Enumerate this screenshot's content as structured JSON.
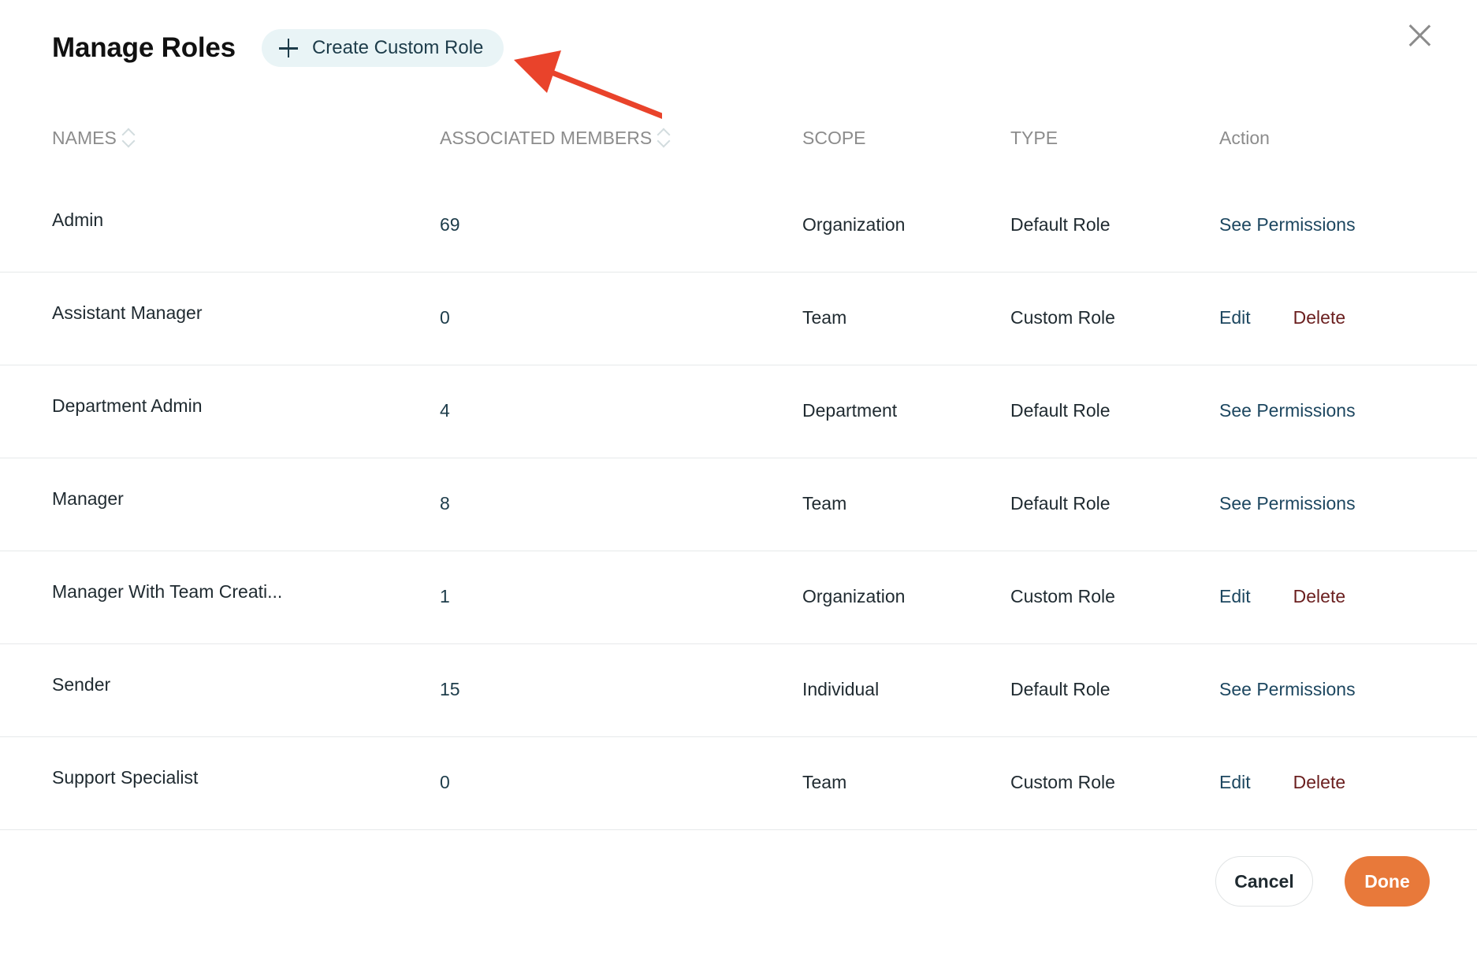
{
  "header": {
    "title": "Manage Roles",
    "create_button_label": "Create Custom Role",
    "create_icon": "plus-icon",
    "close_icon": "close-icon"
  },
  "annotation": {
    "arrow_icon": "red-arrow-icon",
    "arrow_color": "#e9432b"
  },
  "table": {
    "columns": {
      "names": "NAMES",
      "members": "ASSOCIATED MEMBERS",
      "scope": "SCOPE",
      "type": "TYPE",
      "action": "Action"
    },
    "rows": [
      {
        "name": "Admin",
        "members": "69",
        "scope": "Organization",
        "type": "Default Role",
        "action": "See Permissions"
      },
      {
        "name": "Assistant Manager",
        "members": "0",
        "scope": "Team",
        "type": "Custom Role",
        "edit": "Edit",
        "delete": "Delete"
      },
      {
        "name": "Department Admin",
        "members": "4",
        "scope": "Department",
        "type": "Default Role",
        "action": "See Permissions"
      },
      {
        "name": "Manager",
        "members": "8",
        "scope": "Team",
        "type": "Default Role",
        "action": "See Permissions"
      },
      {
        "name": "Manager With Team Creati...",
        "members": "1",
        "scope": "Organization",
        "type": "Custom Role",
        "edit": "Edit",
        "delete": "Delete"
      },
      {
        "name": "Sender",
        "members": "15",
        "scope": "Individual",
        "type": "Default Role",
        "action": "See Permissions"
      },
      {
        "name": "Support Specialist",
        "members": "0",
        "scope": "Team",
        "type": "Custom Role",
        "edit": "Edit",
        "delete": "Delete"
      }
    ]
  },
  "footer": {
    "cancel_label": "Cancel",
    "done_label": "Done"
  },
  "colors": {
    "accent": "#e8793a",
    "link": "#1d4760",
    "delete": "#6b1f1f"
  }
}
